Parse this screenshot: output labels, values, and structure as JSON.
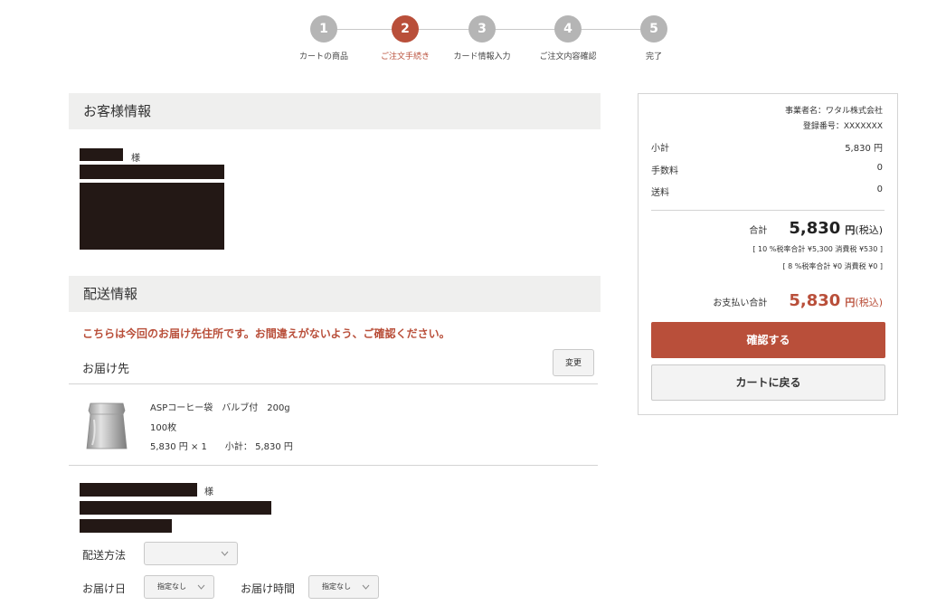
{
  "steps": [
    {
      "number": "1",
      "label": "カートの商品",
      "active": false
    },
    {
      "number": "2",
      "label": "ご注文手続き",
      "active": true
    },
    {
      "number": "3",
      "label": "カード情報入力",
      "active": false
    },
    {
      "number": "4",
      "label": "ご注文内容確認",
      "active": false
    },
    {
      "number": "5",
      "label": "完了",
      "active": false
    }
  ],
  "customer": {
    "heading": "お客様情報",
    "honorific": "様"
  },
  "shipping": {
    "heading": "配送情報",
    "notice": "こちらは今回のお届け先住所です。お間違えがないよう、ご確認ください。",
    "destination_label": "お届け先",
    "change_button": "変更",
    "product": {
      "name": "ASPコーヒー袋　バルブ付　200g",
      "quantity": "100枚",
      "price_line": "5,830 円 × 1　　小計：  5,830 円"
    },
    "recipient_honorific": "様",
    "method_label": "配送方法",
    "method_value": "",
    "date_label": "お届け日",
    "date_value": "指定なし",
    "time_label": "お届け時間",
    "time_value": "指定なし"
  },
  "summary": {
    "business_name": "事業者名：ワタル株式会社",
    "registration": "登録番号：XXXXXXX",
    "subtotal_label": "小計",
    "subtotal_value": "5,830 円",
    "fee_label": "手数料",
    "fee_value": "0",
    "shipping_label": "送料",
    "shipping_value": "0",
    "total_label": "合計",
    "total_amount": "5,830",
    "total_unit": "円",
    "total_tax": "(税込)",
    "tax10": "[ 10 %税率合計 ¥5,300 消費税 ¥530 ]",
    "tax8": "[ 8 %税率合計 ¥0 消費税 ¥0 ]",
    "pay_label": "お支払い合計",
    "pay_amount": "5,830",
    "pay_unit": "円",
    "pay_tax": "(税込)",
    "confirm_button": "確認する",
    "back_button": "カートに戻る"
  },
  "colors": {
    "accent": "#b94f3a",
    "step_inactive": "#b5b5b5",
    "section_bg": "#efefee",
    "redaction": "#231815"
  }
}
